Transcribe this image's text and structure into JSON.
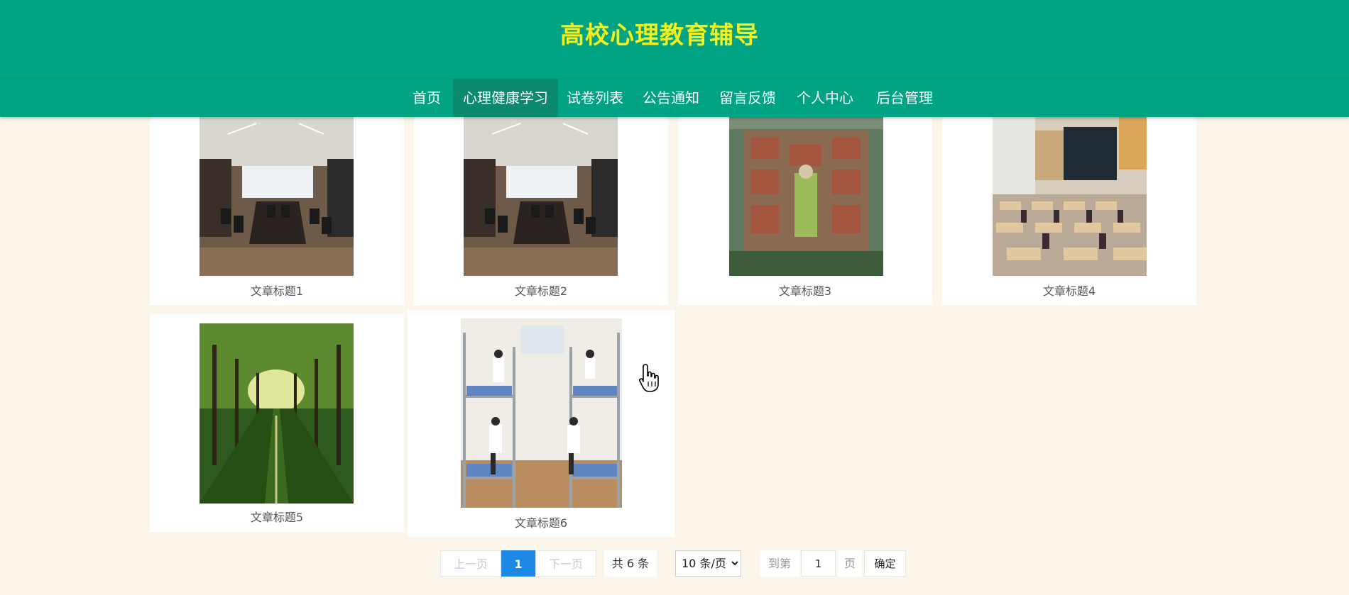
{
  "header": {
    "title": "高校心理教育辅导"
  },
  "nav": {
    "items": [
      {
        "label": "首页"
      },
      {
        "label": "心理健康学习"
      },
      {
        "label": "试卷列表"
      },
      {
        "label": "公告通知"
      },
      {
        "label": "留言反馈"
      },
      {
        "label": "个人中心"
      },
      {
        "label": "后台管理"
      }
    ],
    "active_index": 1
  },
  "articles": [
    {
      "title": "文章标题1",
      "image": "conference-room-photo"
    },
    {
      "title": "文章标题2",
      "image": "conference-room-photo"
    },
    {
      "title": "文章标题3",
      "image": "campus-aerial-photo"
    },
    {
      "title": "文章标题4",
      "image": "classroom-photo"
    },
    {
      "title": "文章标题5",
      "image": "tree-lined-road-photo"
    },
    {
      "title": "文章标题6",
      "image": "dormitory-photo"
    }
  ],
  "pagination": {
    "prev_label": "上一页",
    "current_page": "1",
    "next_label": "下一页",
    "total_label": "共 6 条",
    "page_size_label": "10 条/页",
    "goto_label": "到第",
    "goto_value": "1",
    "page_unit": "页",
    "confirm_label": "确定"
  },
  "colors": {
    "header_bg": "#00a383",
    "title_color": "#f5ef1a",
    "page_bg": "#fcf5e9",
    "active_page": "#1e88e5"
  }
}
